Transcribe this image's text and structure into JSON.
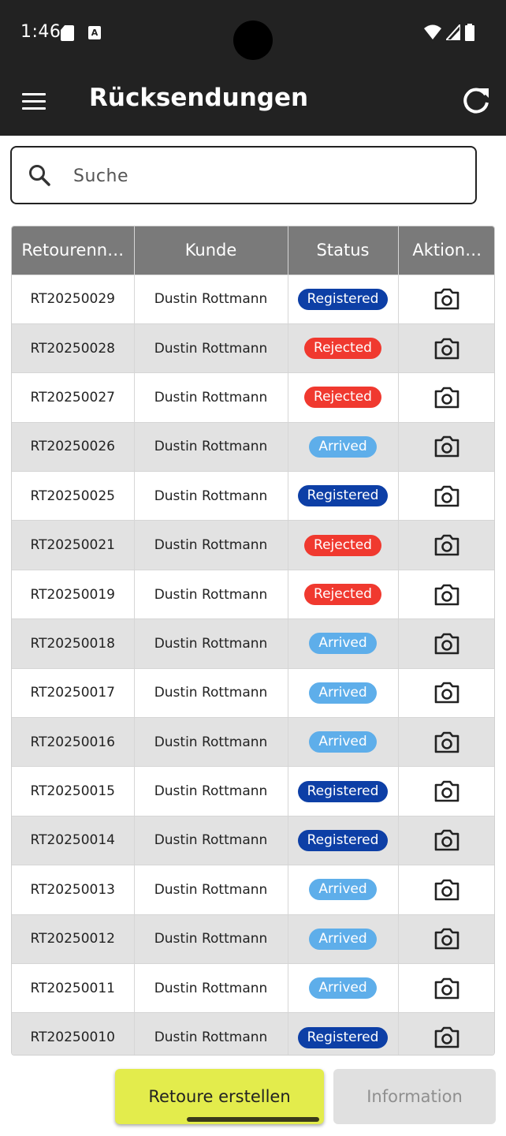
{
  "status_bar": {
    "time": "1:46",
    "a_label": "A"
  },
  "appbar": {
    "title": "Rücksendungen",
    "menu_icon": "menu-icon",
    "refresh_icon": "refresh-icon"
  },
  "search": {
    "placeholder": "Suche",
    "value": ""
  },
  "table": {
    "columns": [
      "Retourenn…",
      "Kunde",
      "Status",
      "Aktion…"
    ],
    "rows": [
      {
        "id": "RT20250029",
        "customer": "Dustin Rottmann",
        "status": "Registered"
      },
      {
        "id": "RT20250028",
        "customer": "Dustin Rottmann",
        "status": "Rejected"
      },
      {
        "id": "RT20250027",
        "customer": "Dustin Rottmann",
        "status": "Rejected"
      },
      {
        "id": "RT20250026",
        "customer": "Dustin Rottmann",
        "status": "Arrived"
      },
      {
        "id": "RT20250025",
        "customer": "Dustin Rottmann",
        "status": "Registered"
      },
      {
        "id": "RT20250021",
        "customer": "Dustin Rottmann",
        "status": "Rejected"
      },
      {
        "id": "RT20250019",
        "customer": "Dustin Rottmann",
        "status": "Rejected"
      },
      {
        "id": "RT20250018",
        "customer": "Dustin Rottmann",
        "status": "Arrived"
      },
      {
        "id": "RT20250017",
        "customer": "Dustin Rottmann",
        "status": "Arrived"
      },
      {
        "id": "RT20250016",
        "customer": "Dustin Rottmann",
        "status": "Arrived"
      },
      {
        "id": "RT20250015",
        "customer": "Dustin Rottmann",
        "status": "Registered"
      },
      {
        "id": "RT20250014",
        "customer": "Dustin Rottmann",
        "status": "Registered"
      },
      {
        "id": "RT20250013",
        "customer": "Dustin Rottmann",
        "status": "Arrived"
      },
      {
        "id": "RT20250012",
        "customer": "Dustin Rottmann",
        "status": "Arrived"
      },
      {
        "id": "RT20250011",
        "customer": "Dustin Rottmann",
        "status": "Arrived"
      },
      {
        "id": "RT20250010",
        "customer": "Dustin Rottmann",
        "status": "Registered"
      }
    ],
    "action_icon": "camera-icon"
  },
  "status_colors": {
    "Registered": "#0d3fa6",
    "Rejected": "#f0392f",
    "Arrived": "#5eaeea"
  },
  "colors": {
    "appbar": "#222222",
    "header": "#7a7a7a",
    "alt_row": "#e2e2e2",
    "primary_button": "#e3ec4c"
  },
  "buttons": {
    "create": "Retoure erstellen",
    "info": "Information"
  }
}
